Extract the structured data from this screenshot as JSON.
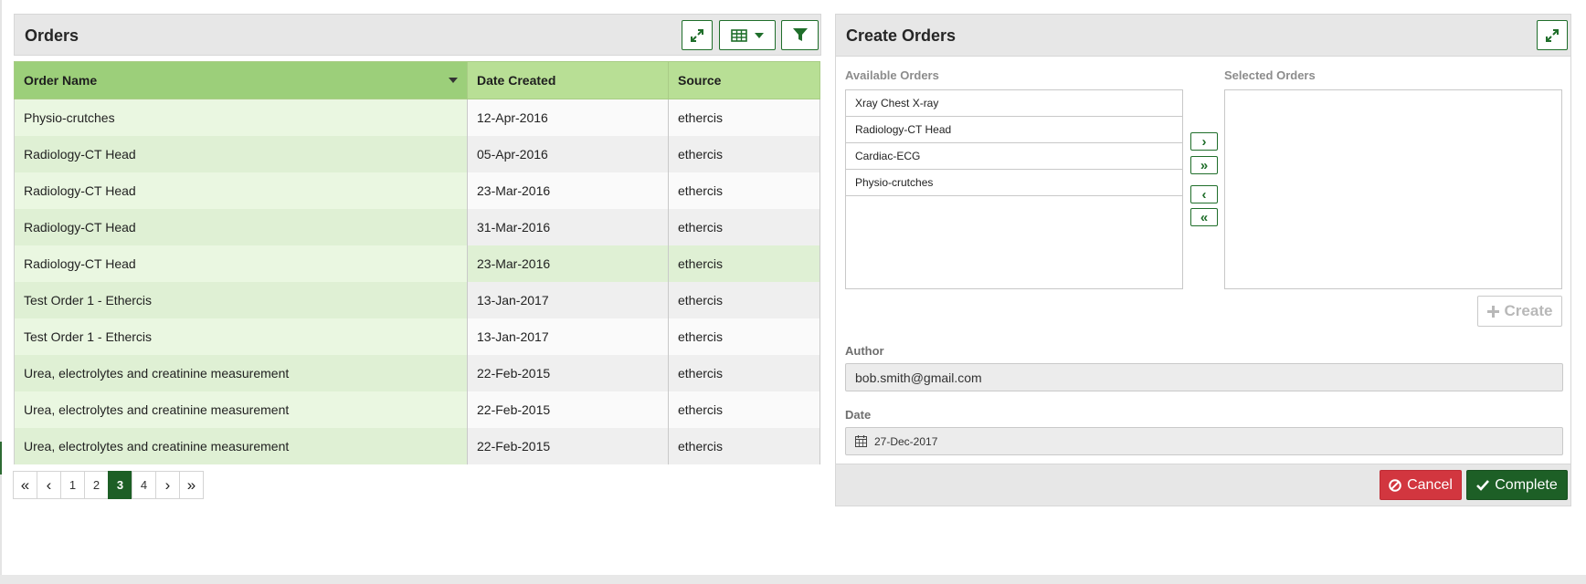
{
  "orders_panel": {
    "title": "Orders",
    "columns": [
      "Order Name",
      "Date Created",
      "Source"
    ],
    "rows": [
      {
        "name": "Physio-crutches",
        "date": "12-Apr-2016",
        "source": "ethercis"
      },
      {
        "name": "Radiology-CT Head",
        "date": "05-Apr-2016",
        "source": "ethercis"
      },
      {
        "name": "Radiology-CT Head",
        "date": "23-Mar-2016",
        "source": "ethercis"
      },
      {
        "name": "Radiology-CT Head",
        "date": "31-Mar-2016",
        "source": "ethercis"
      },
      {
        "name": "Radiology-CT Head",
        "date": "23-Mar-2016",
        "source": "ethercis"
      },
      {
        "name": "Test Order 1 - Ethercis",
        "date": "13-Jan-2017",
        "source": "ethercis"
      },
      {
        "name": "Test Order 1 - Ethercis",
        "date": "13-Jan-2017",
        "source": "ethercis"
      },
      {
        "name": "Urea, electrolytes and creatinine measurement",
        "date": "22-Feb-2015",
        "source": "ethercis"
      },
      {
        "name": "Urea, electrolytes and creatinine measurement",
        "date": "22-Feb-2015",
        "source": "ethercis"
      },
      {
        "name": "Urea, electrolytes and creatinine measurement",
        "date": "22-Feb-2015",
        "source": "ethercis"
      }
    ],
    "pagination": {
      "first": "«",
      "prev": "‹",
      "pages": [
        "1",
        "2",
        "3",
        "4"
      ],
      "current": "3",
      "next": "›",
      "last": "»"
    },
    "icons": [
      "expand-icon",
      "table-columns-icon",
      "caret-down-icon",
      "filter-icon",
      "sort-desc-icon"
    ]
  },
  "create_panel": {
    "title": "Create Orders",
    "available_label": "Available Orders",
    "selected_label": "Selected Orders",
    "available_items": [
      "Xray Chest X-ray",
      "Radiology-CT Head",
      "Cardiac-ECG",
      "Physio-crutches"
    ],
    "selected_items": [],
    "move_buttons": {
      "move_one_right": "›",
      "move_all_right": "»",
      "move_one_left": "‹",
      "move_all_left": "«"
    },
    "create_button": "Create",
    "author_label": "Author",
    "author_value": "bob.smith@gmail.com",
    "date_label": "Date",
    "date_value": "27-Dec-2017",
    "cancel_button": "Cancel",
    "complete_button": "Complete"
  },
  "colors": {
    "brand_green": "#1d5f26",
    "header_green": "#9ccf7a",
    "header_light_green": "#b8df95",
    "cancel_red": "#d2363f"
  }
}
